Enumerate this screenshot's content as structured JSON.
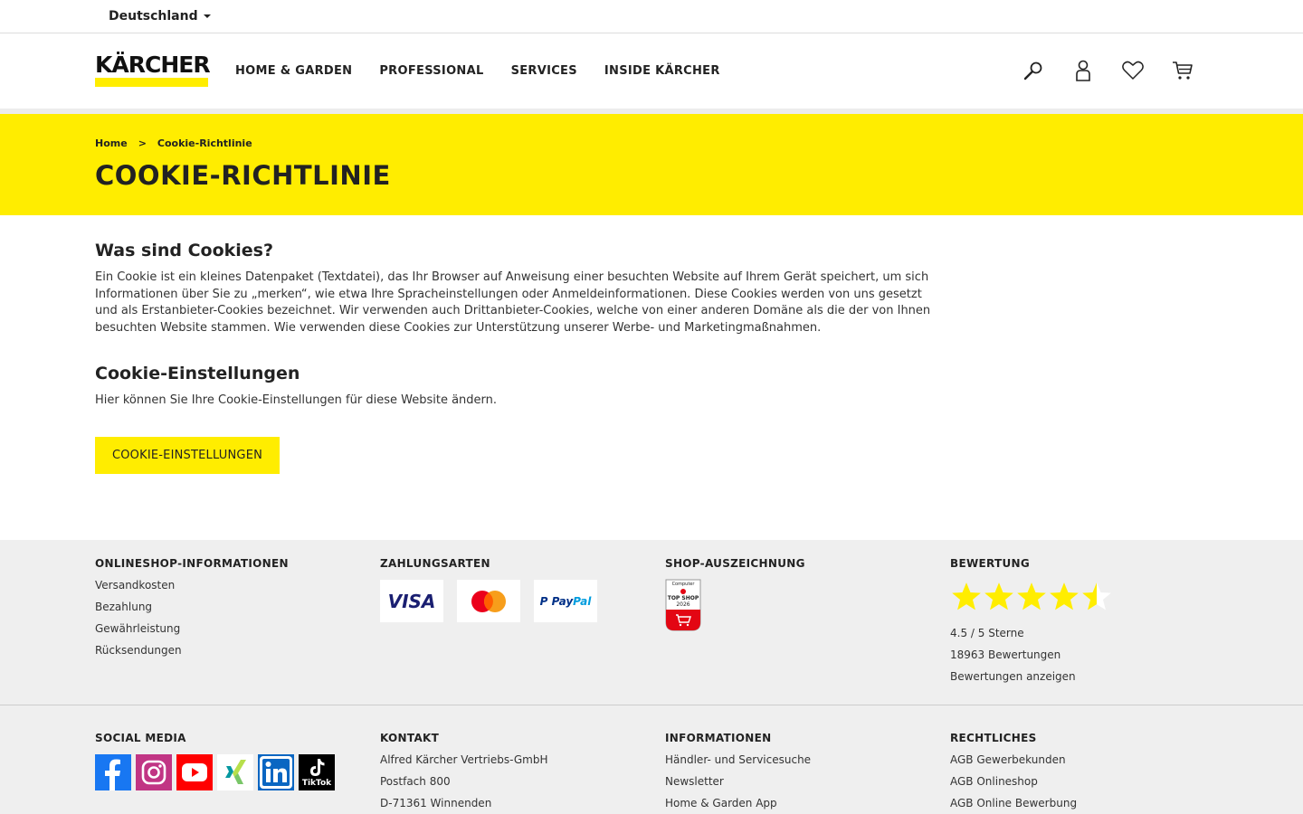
{
  "topbar": {
    "country": "Deutschland"
  },
  "brand": {
    "logo_text": "KÄRCHER",
    "accent": "#ffed00"
  },
  "nav": {
    "items": [
      "HOME & GARDEN",
      "PROFESSIONAL",
      "SERVICES",
      "INSIDE KÄRCHER"
    ]
  },
  "header_icons": [
    "search-icon",
    "account-icon",
    "wishlist-icon",
    "cart-icon"
  ],
  "breadcrumb": {
    "home": "Home",
    "separator": ">",
    "current": "Cookie-Richtlinie"
  },
  "page_title": "COOKIE-RICHTLINIE",
  "section1": {
    "heading": "Was sind Cookies?",
    "text": "Ein Cookie ist ein kleines Datenpaket (Textdatei), das Ihr Browser auf Anweisung einer besuchten Website auf Ihrem Gerät speichert, um sich Informationen über Sie zu „merken“, wie etwa Ihre Spracheinstellungen oder Anmeldeinformationen. Diese Cookies werden von uns gesetzt und als Erstanbieter-Cookies bezeichnet. Wir verwenden auch Drittanbieter-Cookies, welche von einer anderen Domäne als die der von Ihnen besuchten Website stammen. Wie verwenden diese Cookies zur Unterstützung unserer Werbe- und Marketingmaßnahmen."
  },
  "section2": {
    "heading": "Cookie-Einstellungen",
    "text": "Hier können Sie Ihre Cookie-Einstellungen für diese Website ändern.",
    "button": "COOKIE-EINSTELLUNGEN"
  },
  "footer": {
    "shopinfo": {
      "heading": "ONLINESHOP-INFORMATIONEN",
      "links": [
        "Versandkosten",
        "Bezahlung",
        "Gewährleistung",
        "Rücksendungen"
      ]
    },
    "payment": {
      "heading": "ZAHLUNGSARTEN",
      "visa": "VISA",
      "paypal_p": "P",
      "paypal_pay": "Pay",
      "paypal_pal": "Pal"
    },
    "award": {
      "heading": "SHOP-AUSZEICHNUNG",
      "badge_top": "Computer",
      "badge_line1": "TOP SHOP",
      "badge_line2": "2026"
    },
    "rating": {
      "heading": "BEWERTUNG",
      "value": 4.5,
      "max": 5,
      "score_text": "4.5 / 5 Sterne",
      "count_text": "18963 Bewertungen",
      "link": "Bewertungen anzeigen"
    },
    "social": {
      "heading": "SOCIAL MEDIA",
      "icons": [
        "facebook-icon",
        "instagram-icon",
        "youtube-icon",
        "xing-icon",
        "linkedin-icon",
        "tiktok-icon"
      ],
      "tiktok_label": "TikTok"
    },
    "contact": {
      "heading": "KONTAKT",
      "lines": [
        "Alfred Kärcher Vertriebs-GmbH",
        "Postfach 800",
        "D-71361 Winnenden"
      ]
    },
    "info": {
      "heading": "INFORMATIONEN",
      "links": [
        "Händler- und Servicesuche",
        "Newsletter",
        "Home & Garden App"
      ]
    },
    "legal": {
      "heading": "RECHTLICHES",
      "links": [
        "AGB Gewerbekunden",
        "AGB Onlineshop",
        "AGB Online Bewerbung"
      ]
    }
  }
}
